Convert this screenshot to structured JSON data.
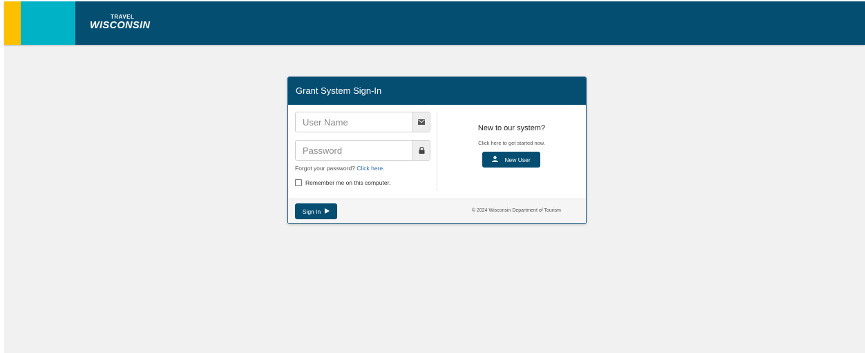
{
  "header": {
    "logo_top": "TRAVEL",
    "logo_main": "WISCONSIN",
    "colors": {
      "bar": "#044e72",
      "yellow": "#fdc000",
      "teal": "#00b2c6"
    }
  },
  "login": {
    "title": "Grant System Sign-In",
    "username_placeholder": "User Name",
    "username_icon": "envelope-icon",
    "password_placeholder": "Password",
    "password_icon": "lock-icon",
    "forgot_text": "Forgot your password?",
    "forgot_link": "Click here.",
    "remember_label": "Remember me on this computer.",
    "remember_checked": false,
    "new_title": "New to our system?",
    "new_subtitle": "Click here to get started now.",
    "new_user_button": "New User",
    "new_user_icon": "user-icon",
    "signin_button": "Sign In",
    "signin_icon": "play-arrow-icon",
    "copyright": "© 2024 Wisconsin Department of Tourism"
  }
}
